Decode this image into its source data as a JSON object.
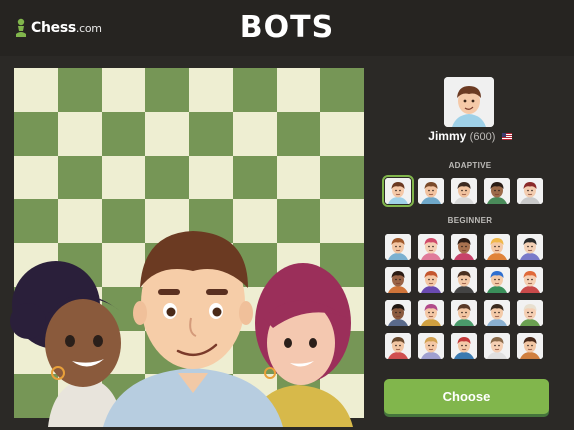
{
  "header": {
    "logo_name": "Chess",
    "logo_suffix": ".com",
    "title": "BOTS"
  },
  "colors": {
    "board_light": "#eeeed2",
    "board_dark": "#769656",
    "accent_green": "#81b64c",
    "background": "#2b2926"
  },
  "selected_bot": {
    "name": "Jimmy",
    "rating": "(600)",
    "flag": "us-flag-icon"
  },
  "sections": {
    "adaptive": "ADAPTIVE",
    "beginner": "BEGINNER"
  },
  "adaptive_bots": [
    {
      "skin": "#f5c9a8",
      "hair": "#6b3a22",
      "shirt": "#9fd1e8"
    },
    {
      "skin": "#f2c3a0",
      "hair": "#7a4a2a",
      "shirt": "#6fa8c9"
    },
    {
      "skin": "#f0c29e",
      "hair": "#3b2a20",
      "shirt": "#d9d9d9"
    },
    {
      "skin": "#9c6b4a",
      "hair": "#2a1d16",
      "shirt": "#4a8b5a"
    },
    {
      "skin": "#f3cdb0",
      "hair": "#8a2a2a",
      "shirt": "#c9c9c9"
    }
  ],
  "beginner_bots": [
    {
      "skin": "#f2c6a3",
      "hair": "#a05a2c",
      "shirt": "#7bb0d0"
    },
    {
      "skin": "#f5cfb3",
      "hair": "#d04a6a",
      "shirt": "#e07a9a"
    },
    {
      "skin": "#a8714f",
      "hair": "#2b1b14",
      "shirt": "#c7426a"
    },
    {
      "skin": "#f4c9a6",
      "hair": "#f0b84a",
      "shirt": "#e0833a"
    },
    {
      "skin": "#f3d0b5",
      "hair": "#2a2a2a",
      "shirt": "#7a7ac9"
    },
    {
      "skin": "#9a6447",
      "hair": "#2b1b14",
      "shirt": "#d0753a"
    },
    {
      "skin": "#f4c8a6",
      "hair": "#c4562e",
      "shirt": "#6a4ab0"
    },
    {
      "skin": "#f2c7a5",
      "hair": "#4a3020",
      "shirt": "#444444"
    },
    {
      "skin": "#f3caa8",
      "hair": "#2e6fd0",
      "shirt": "#3a8f5a"
    },
    {
      "skin": "#f5cfb3",
      "hair": "#e06a3a",
      "shirt": "#c94a4a"
    },
    {
      "skin": "#8a5a3e",
      "hair": "#1f1712",
      "shirt": "#5a6a8a"
    },
    {
      "skin": "#f4c8a6",
      "hair": "#b04a8a",
      "shirt": "#d0a040"
    },
    {
      "skin": "#f2c6a3",
      "hair": "#5a3a28",
      "shirt": "#4a9a6a"
    },
    {
      "skin": "#f3caa8",
      "hair": "#3a2a1e",
      "shirt": "#8ab0d0"
    },
    {
      "skin": "#f5cfb3",
      "hair": "#e8e0d0",
      "shirt": "#6aa050"
    },
    {
      "skin": "#f2c6a3",
      "hair": "#6a4a2e",
      "shirt": "#d05050"
    },
    {
      "skin": "#f4c8a6",
      "hair": "#d0a050",
      "shirt": "#a0a0d0"
    },
    {
      "skin": "#f3caa8",
      "hair": "#c43a3a",
      "shirt": "#3a7ab0"
    },
    {
      "skin": "#f5cfb3",
      "hair": "#8a6a4a",
      "shirt": "#e0e0e0"
    },
    {
      "skin": "#f2c6a3",
      "hair": "#4a2a1a",
      "shirt": "#d08040"
    }
  ],
  "choose_label": "Choose"
}
